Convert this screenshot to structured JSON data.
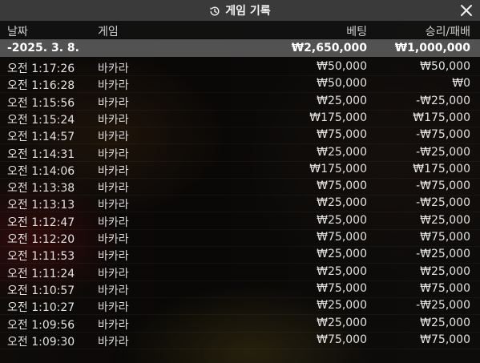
{
  "title": "게임 기록",
  "columns": {
    "date": "날짜",
    "game": "게임",
    "bet": "베팅",
    "result": "승리/패배"
  },
  "day_row": {
    "date": "-2025. 3. 8.",
    "bet": "₩2,650,000",
    "result": "₩1,000,000"
  },
  "rows": [
    {
      "time": "오전 1:17:26",
      "game": "바카라",
      "bet": "₩50,000",
      "result": "₩50,000"
    },
    {
      "time": "오전 1:16:28",
      "game": "바카라",
      "bet": "₩50,000",
      "result": "₩0"
    },
    {
      "time": "오전 1:15:56",
      "game": "바카라",
      "bet": "₩25,000",
      "result": "-₩25,000"
    },
    {
      "time": "오전 1:15:24",
      "game": "바카라",
      "bet": "₩175,000",
      "result": "₩175,000"
    },
    {
      "time": "오전 1:14:57",
      "game": "바카라",
      "bet": "₩75,000",
      "result": "-₩75,000"
    },
    {
      "time": "오전 1:14:31",
      "game": "바카라",
      "bet": "₩25,000",
      "result": "-₩25,000"
    },
    {
      "time": "오전 1:14:06",
      "game": "바카라",
      "bet": "₩175,000",
      "result": "₩175,000"
    },
    {
      "time": "오전 1:13:38",
      "game": "바카라",
      "bet": "₩75,000",
      "result": "-₩75,000"
    },
    {
      "time": "오전 1:13:13",
      "game": "바카라",
      "bet": "₩25,000",
      "result": "-₩25,000"
    },
    {
      "time": "오전 1:12:47",
      "game": "바카라",
      "bet": "₩25,000",
      "result": "₩25,000"
    },
    {
      "time": "오전 1:12:20",
      "game": "바카라",
      "bet": "₩75,000",
      "result": "₩75,000"
    },
    {
      "time": "오전 1:11:53",
      "game": "바카라",
      "bet": "₩25,000",
      "result": "-₩25,000"
    },
    {
      "time": "오전 1:11:24",
      "game": "바카라",
      "bet": "₩25,000",
      "result": "₩25,000"
    },
    {
      "time": "오전 1:10:57",
      "game": "바카라",
      "bet": "₩75,000",
      "result": "₩75,000"
    },
    {
      "time": "오전 1:10:27",
      "game": "바카라",
      "bet": "₩25,000",
      "result": "-₩25,000"
    },
    {
      "time": "오전 1:09:56",
      "game": "바카라",
      "bet": "₩25,000",
      "result": "₩25,000"
    },
    {
      "time": "오전 1:09:30",
      "game": "바카라",
      "bet": "₩75,000",
      "result": "₩75,000"
    }
  ],
  "icons": {
    "title": "history-icon",
    "close": "close-icon"
  },
  "colors": {
    "titlebar": "#3a3a3a",
    "day_row": "#5f5f5f",
    "text": "#e8e8e8"
  }
}
